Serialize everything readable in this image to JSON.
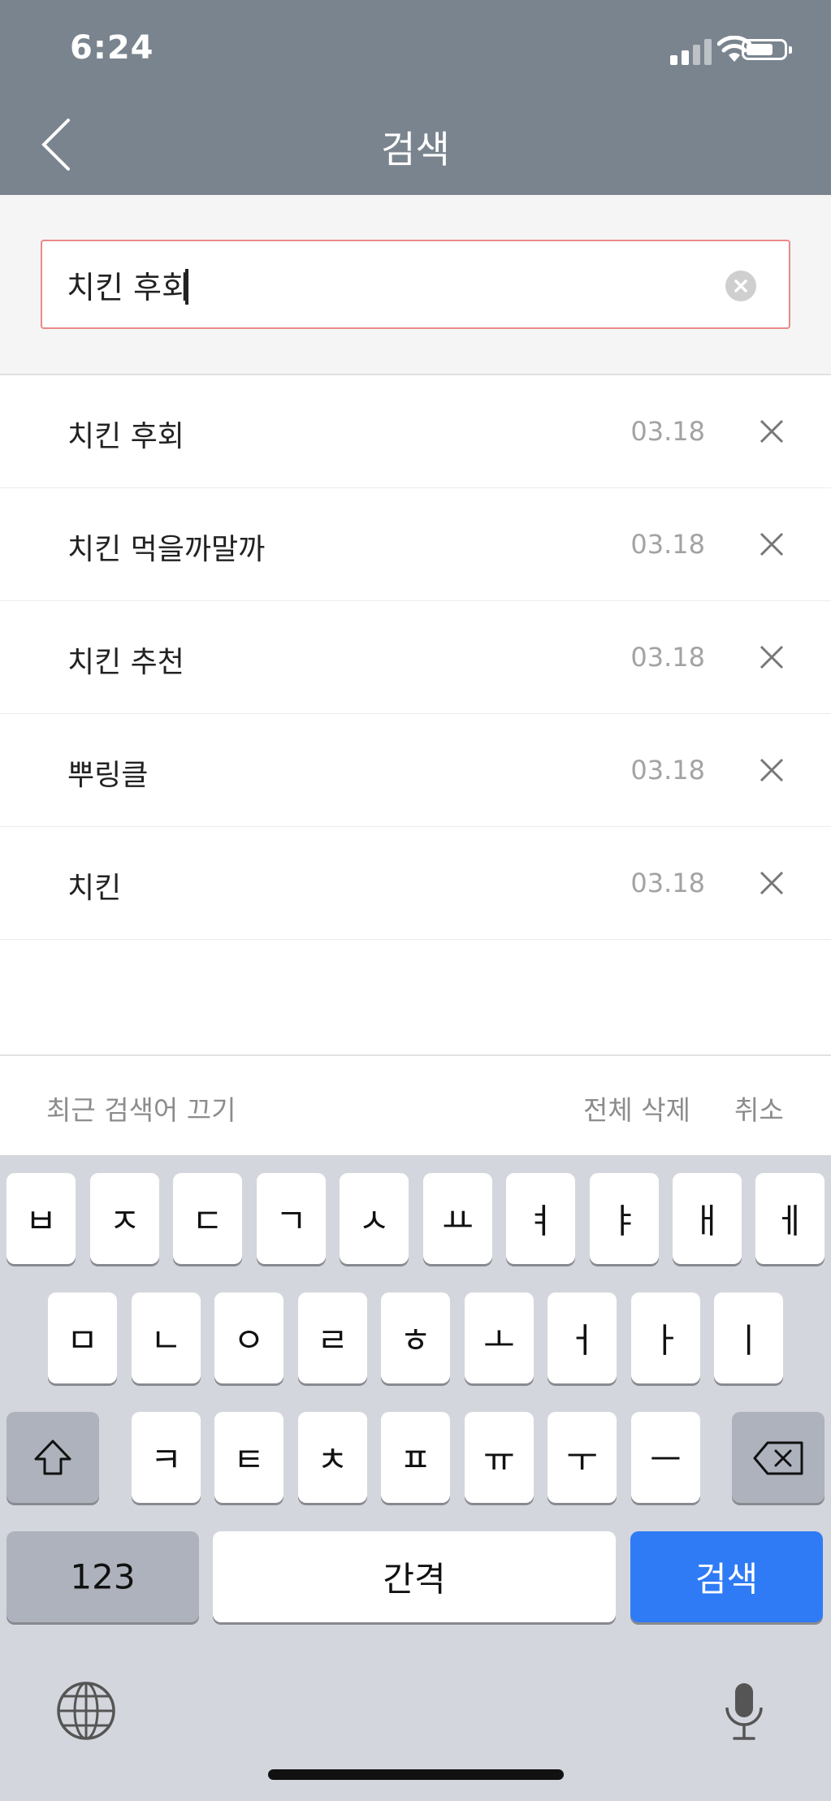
{
  "status_bar": {
    "time": "6:24"
  },
  "header": {
    "title": "검색"
  },
  "search": {
    "value": "치킨 후회"
  },
  "recent": [
    {
      "text": "치킨 후회",
      "date": "03.18"
    },
    {
      "text": "치킨 먹을까말까",
      "date": "03.18"
    },
    {
      "text": "치킨 추천",
      "date": "03.18"
    },
    {
      "text": "뿌링클",
      "date": "03.18"
    },
    {
      "text": "치킨",
      "date": "03.18"
    }
  ],
  "footer": {
    "disable_recent": "최근 검색어 끄기",
    "delete_all": "전체 삭제",
    "cancel": "취소"
  },
  "keyboard": {
    "row1": [
      "ㅂ",
      "ㅈ",
      "ㄷ",
      "ㄱ",
      "ㅅ",
      "ㅛ",
      "ㅕ",
      "ㅑ",
      "ㅐ",
      "ㅔ"
    ],
    "row2": [
      "ㅁ",
      "ㄴ",
      "ㅇ",
      "ㄹ",
      "ㅎ",
      "ㅗ",
      "ㅓ",
      "ㅏ",
      "ㅣ"
    ],
    "row3": [
      "ㅋ",
      "ㅌ",
      "ㅊ",
      "ㅍ",
      "ㅠ",
      "ㅜ",
      "ㅡ"
    ],
    "numbers": "123",
    "space": "간격",
    "search": "검색"
  },
  "colors": {
    "header_bg": "#7a848e",
    "search_key": "#2f7bf6",
    "input_border": "#e98a8a"
  }
}
